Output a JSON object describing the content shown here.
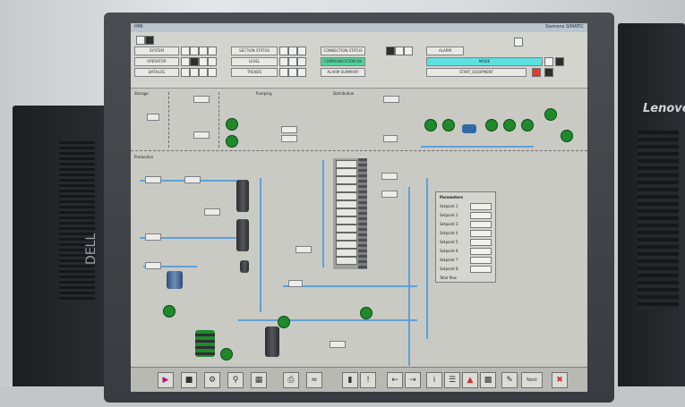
{
  "environment": {
    "left_case_badge": "DELL",
    "right_case_label": "Lenovo"
  },
  "window": {
    "title": "HMI",
    "right_caption": "Siemens SIMATIC"
  },
  "topbar": {
    "row1": [
      "SYSTEM",
      "SECTION STATUS",
      "CONNECTION STATUS",
      "ALARM"
    ],
    "row2": [
      "OPERATOR",
      "LEVEL",
      "COMMUNICATION OK",
      "MODE"
    ],
    "row3": [
      "DATALOG",
      "TRENDS",
      "ALARM SUMMARY",
      "START_EQUIPMENT"
    ]
  },
  "sections": {
    "upper_left": "Storage",
    "upper_middle": "Pumping",
    "upper_right": "Distribution",
    "lower_left": "Production"
  },
  "rack": {
    "rows": [
      "",
      "",
      "",
      "",
      "",
      "",
      "",
      "",
      "",
      "",
      "",
      "",
      "",
      ""
    ]
  },
  "table": {
    "title": "Parameters",
    "rows": [
      "Setpoint 1",
      "Setpoint 2",
      "Setpoint 3",
      "Setpoint 4",
      "Setpoint 5",
      "Setpoint 6",
      "Setpoint 7",
      "Setpoint 8"
    ],
    "footer": "Total flow"
  },
  "toolbar": {
    "next_label": "Next"
  },
  "colors": {
    "pipe": "#5fa0d8",
    "pump": "#1f8a2a",
    "alarm_red": "#e53c2a",
    "status_cyan": "#5ee0e0"
  }
}
